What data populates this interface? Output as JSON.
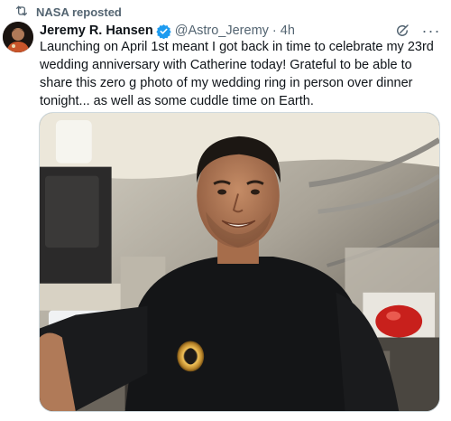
{
  "repost": {
    "icon": "repost-icon",
    "label": "NASA reposted"
  },
  "tweet": {
    "author_name": "Jeremy R. Hansen",
    "verified_icon": "verified-badge-icon",
    "verified_color": "#1d9bf0",
    "handle": "@Astro_Jeremy",
    "separator": "·",
    "time": "4h",
    "text": "Launching on April 1st meant I got back in time to celebrate my 23rd wedding anniversary with Catherine today! Grateful to be able to share this zero g photo of my wedding ring in person over dinner tonight... as well as some cuddle time on Earth.",
    "media_icon": "astronaut-ring-photo"
  },
  "actions": {
    "grok_icon": "grok-icon",
    "more_icon": "more-options-icon",
    "more_glyph": "···"
  },
  "colors": {
    "text_primary": "#0f1419",
    "text_secondary": "#536471",
    "border": "#cfd9de"
  }
}
